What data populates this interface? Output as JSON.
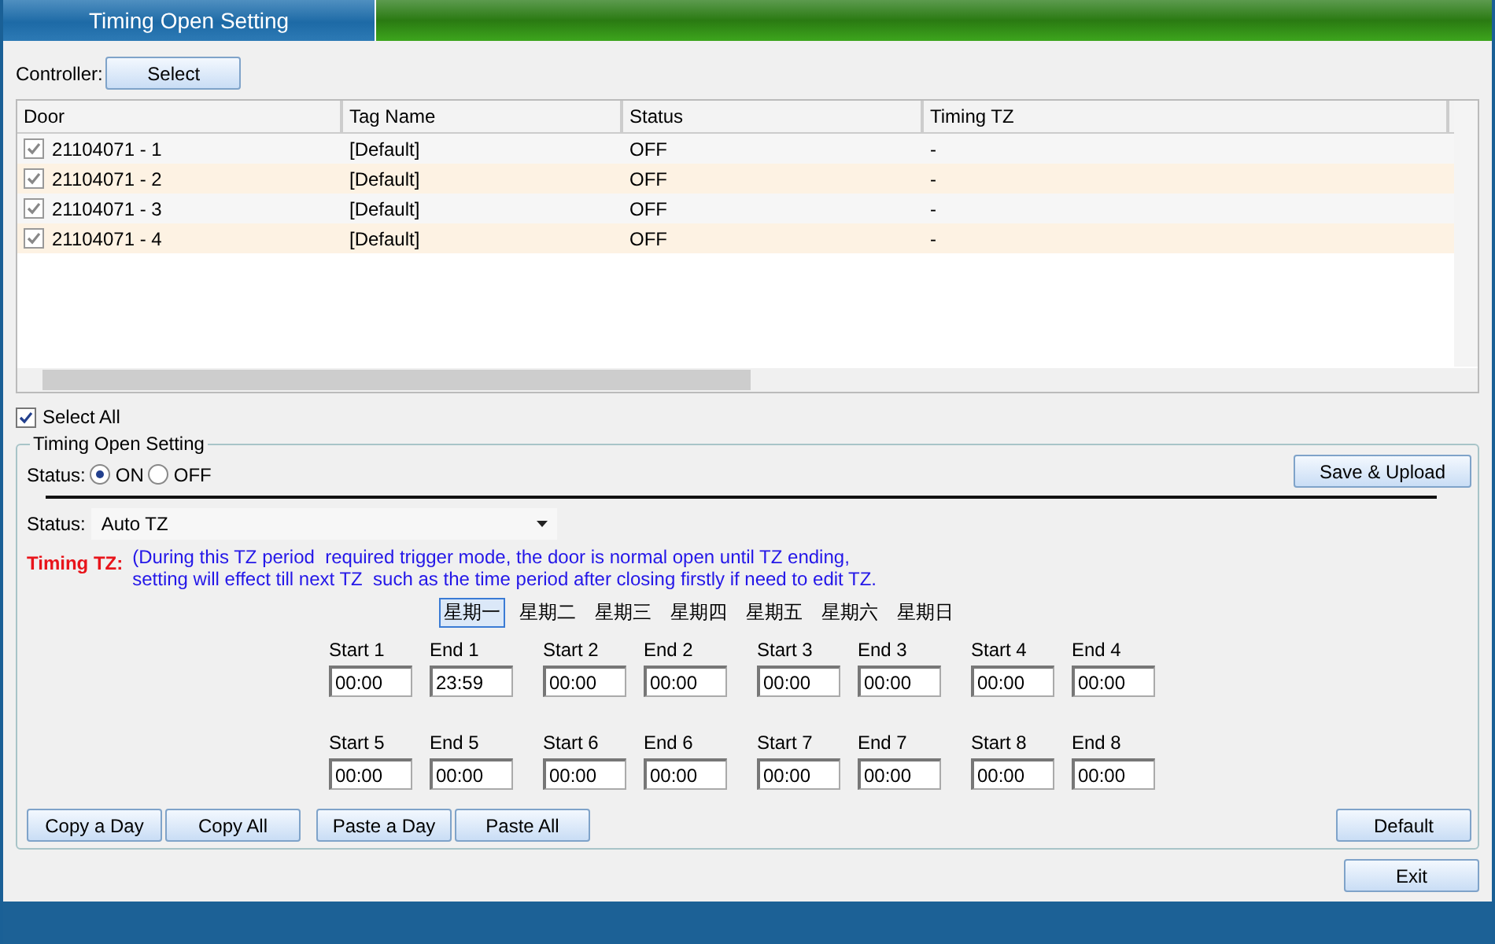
{
  "window": {
    "title": "Timing Open Setting"
  },
  "controller": {
    "label": "Controller:",
    "button": "Select"
  },
  "table": {
    "columns": [
      "Door",
      "Tag Name",
      "Status",
      "Timing TZ"
    ],
    "rows": [
      {
        "door": "21104071 - 1",
        "checked": true,
        "tag_name": "[Default]",
        "status": "OFF",
        "timing_tz": "-"
      },
      {
        "door": "21104071 - 2",
        "checked": true,
        "tag_name": "[Default]",
        "status": "OFF",
        "timing_tz": "-"
      },
      {
        "door": "21104071 - 3",
        "checked": true,
        "tag_name": "[Default]",
        "status": "OFF",
        "timing_tz": "-"
      },
      {
        "door": "21104071 - 4",
        "checked": true,
        "tag_name": "[Default]",
        "status": "OFF",
        "timing_tz": "-"
      }
    ]
  },
  "select_all": {
    "label": "Select All",
    "checked": true
  },
  "group": {
    "title": "Timing Open Setting",
    "status_label": "Status:",
    "radios": [
      {
        "label": "ON",
        "selected": true
      },
      {
        "label": "OFF",
        "selected": false
      }
    ],
    "save_button": "Save & Upload",
    "mode": {
      "label": "Status:",
      "value": "Auto TZ"
    },
    "timing_tz": {
      "label": "Timing TZ:",
      "note_lines": [
        "(During this TZ period  required trigger mode, the door is normal open until TZ ending,",
        "setting will effect till next TZ  such as the time period after closing firstly if need to edit TZ."
      ]
    },
    "days": [
      {
        "label": "星期一",
        "selected": true
      },
      {
        "label": "星期二",
        "selected": false
      },
      {
        "label": "星期三",
        "selected": false
      },
      {
        "label": "星期四",
        "selected": false
      },
      {
        "label": "星期五",
        "selected": false
      },
      {
        "label": "星期六",
        "selected": false
      },
      {
        "label": "星期日",
        "selected": false
      }
    ],
    "slots": [
      {
        "label": "Start 1",
        "value": "00:00"
      },
      {
        "label": "End 1",
        "value": "23:59"
      },
      {
        "label": "Start 2",
        "value": "00:00"
      },
      {
        "label": "End 2",
        "value": "00:00"
      },
      {
        "label": "Start 3",
        "value": "00:00"
      },
      {
        "label": "End 3",
        "value": "00:00"
      },
      {
        "label": "Start 4",
        "value": "00:00"
      },
      {
        "label": "End 4",
        "value": "00:00"
      },
      {
        "label": "Start 5",
        "value": "00:00"
      },
      {
        "label": "End 5",
        "value": "00:00"
      },
      {
        "label": "Start 6",
        "value": "00:00"
      },
      {
        "label": "End 6",
        "value": "00:00"
      },
      {
        "label": "Start 7",
        "value": "00:00"
      },
      {
        "label": "End 7",
        "value": "00:00"
      },
      {
        "label": "Start 8",
        "value": "00:00"
      },
      {
        "label": "End 8",
        "value": "00:00"
      }
    ],
    "copy_buttons": [
      "Copy a Day",
      "Copy All"
    ],
    "paste_buttons": [
      "Paste a Day",
      "Paste All"
    ],
    "default_button": "Default"
  },
  "exit_button": "Exit"
}
